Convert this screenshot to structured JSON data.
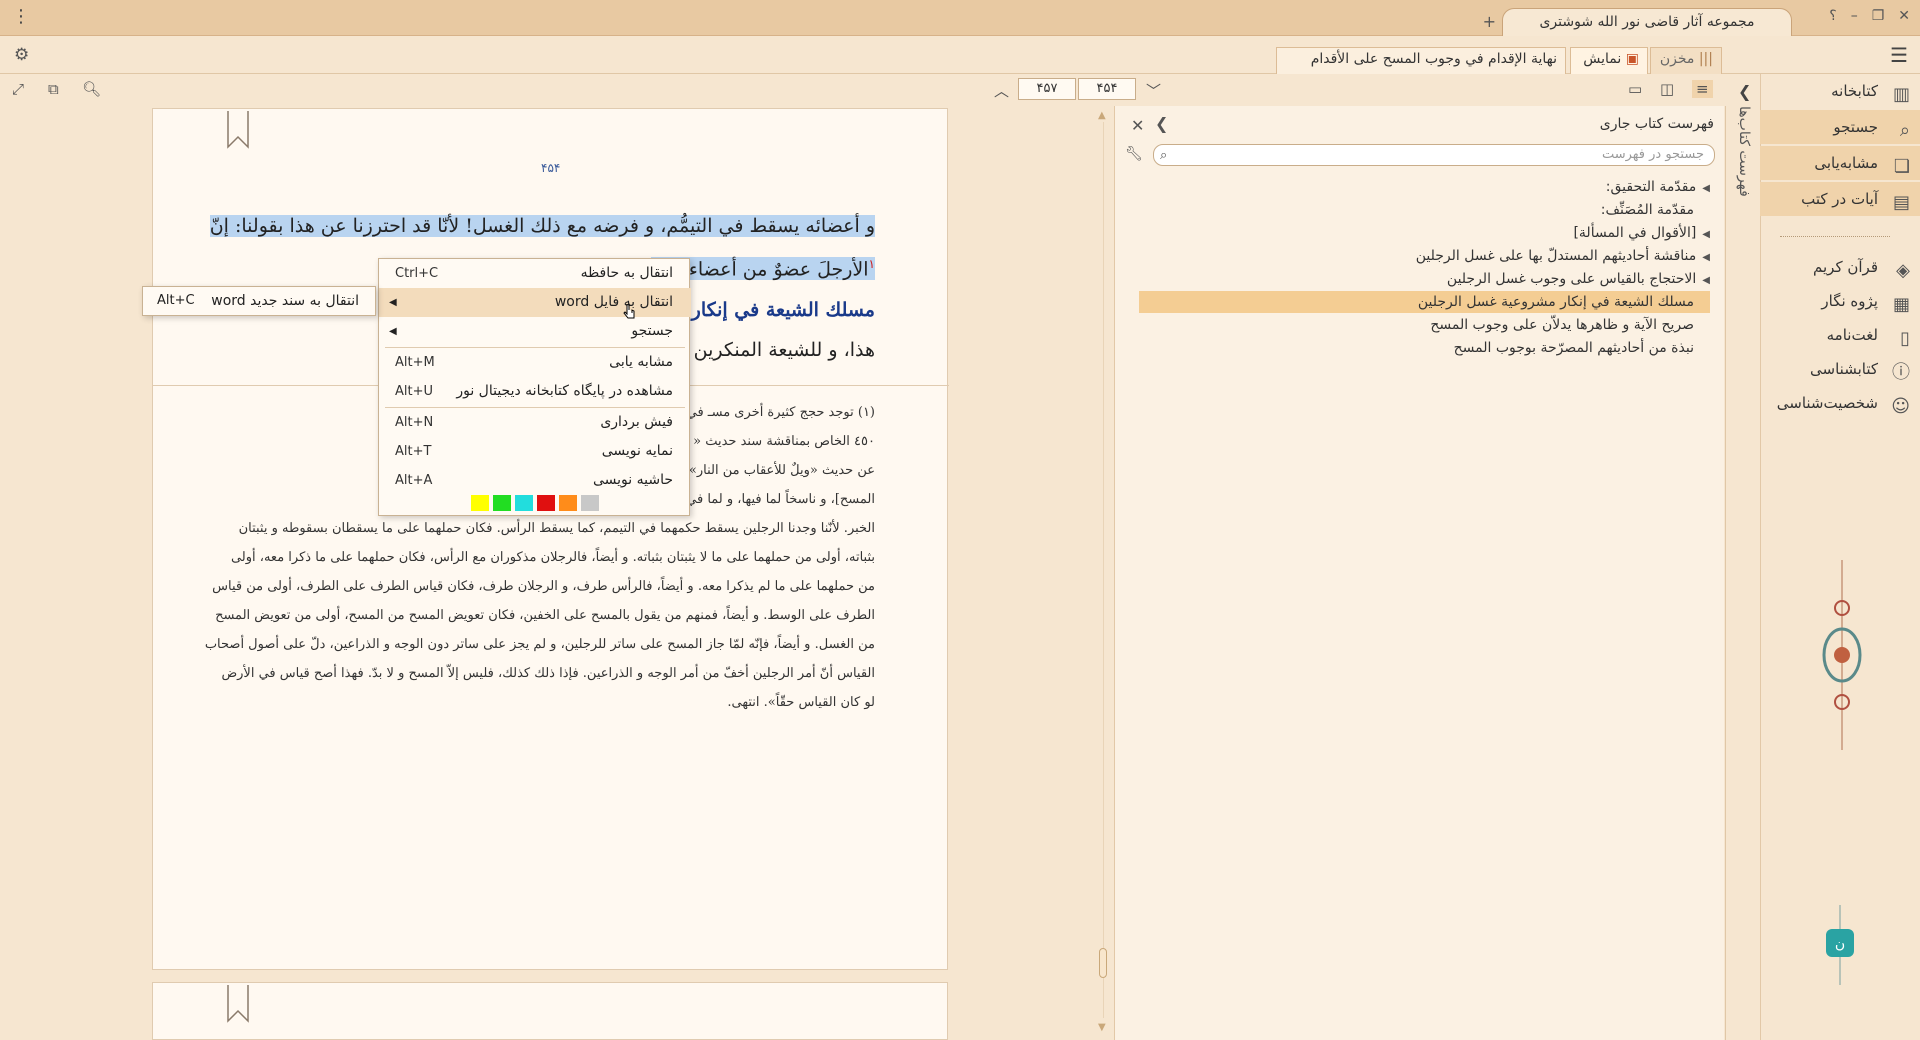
{
  "app": {
    "title": "مجموعه آثار قاضی نور الله شوشتری",
    "add_tab": "+",
    "help": "؟",
    "minimize": "–",
    "restore": "❐",
    "close": "✕"
  },
  "tabs": {
    "store": "مخزن",
    "view": "نمایش",
    "book": "نهاية الإقدام في وجوب المسح على الأقدام"
  },
  "toolbar": {
    "page_current": "۴۵۴",
    "page_total": "۴۵۷"
  },
  "nav": {
    "items": [
      {
        "label": "کتابخانه",
        "icon": "library-icon"
      },
      {
        "label": "جستجو",
        "icon": "search-icon"
      },
      {
        "label": "مشابه‌یابی",
        "icon": "similar-icon"
      },
      {
        "label": "آیات در کتب",
        "icon": "verses-icon"
      },
      {
        "label": "قرآن کریم",
        "icon": "quran-icon"
      },
      {
        "label": "پژوه نگار",
        "icon": "notes-icon"
      },
      {
        "label": "لغت‌نامه",
        "icon": "dictionary-icon"
      },
      {
        "label": "کتابشناسی",
        "icon": "bibliography-icon"
      },
      {
        "label": "شخصیت‌شناسی",
        "icon": "person-icon"
      }
    ],
    "vertical_tab": "فهرست کتاب‌ها"
  },
  "toc": {
    "title": "فهرست کتاب جاری",
    "search_placeholder": "جستجو در فهرست",
    "rows": [
      {
        "label": "مقدّمة التحقيق:",
        "expandable": true
      },
      {
        "label": "مقدّمة المُصَنِّف:",
        "expandable": false
      },
      {
        "label": "[الأقوال في المسألة]",
        "expandable": true
      },
      {
        "label": "مناقشة أحاديثهم المستدلّ بها على غسل الرجلين",
        "expandable": true
      },
      {
        "label": "الاحتجاج بالقياس على وجوب غسل الرجلين",
        "expandable": true
      },
      {
        "label": "مسلك الشيعة في إنكار مشروعية غسل الرجلين",
        "expandable": false,
        "selected": true
      },
      {
        "label": "صريح الآية و ظاهرها يدلاّن على وجوب المسح",
        "expandable": false
      },
      {
        "label": "نبذة من أحاديثهم المصرّحة بوجوب المسح",
        "expandable": false
      }
    ]
  },
  "page": {
    "number": "۴۵۴",
    "lines": [
      "و أعضائه يسقط في التيمُّم، و فرضه مع ذلك الغسل! لأنّا قد احترزنا عن هذا بقولنا: إنّ",
      "الأرجلَ عضوٌ من أعضاء الطـ",
      "مسلك الشيعة في إنكار مشـ",
      "هذا، و للشيعة المنكرين لـ"
    ],
    "footnotes": [
      "(١) توجد حجج كثيرة أخرى مسـ                                         في آخر الهامش رقم ١ ص",
      "٤٥٠ الخاص بمناقشة سند حديث «                              المحلّى ٥٧/٢ مسألة ٢٠٠",
      "عن حديث «ويلٌ للأعقاب من النار»                              ر التي ذكرنا [يعني بها أخبار",
      "المسح]، و ناسخاً لما فيها، و لما في                              الصحاح للقياس أن يترك هذا",
      "الخبر. لأنّنا وجدنا الرجلين يسقط حكمهما في التيمم، كما يسقط الرأس. فكان حملهما على ما يسقطان بسقوطه و يثبتان",
      "بثباته، أولى من حملهما على ما لا يثبتان بثباته. و أيضاً، فالرجلان مذكوران مع الرأس، فكان حملهما على ما ذكرا معه، أولى",
      "من حملهما على ما لم يذكرا معه. و أيضاً، فالرأس طرف، و الرجلان طرف، فكان قياس الطرف على الطرف، أولى من قياس",
      "الطرف على الوسط. و أيضاً، فمنهم من يقول بالمسح على الخفين، فكان تعويض المسح من المسح، أولى من تعويض المسح",
      "من الغسل. و أيضاً، فإنّه لمّا جاز المسح على ساتر للرجلين، و لم يجز على ساتر دون الوجه و الذراعين، دلّ على أصول أصحاب",
      "القياس أنّ أمر الرجلين أخفّ من أمر الوجه و الذراعين. فإذا ذلك كذلك، فليس إلاّ المسح و لا بدّ. فهذا أصح قياس في الأرض",
      "لو كان القياس حقّاً». انتهى."
    ],
    "footnote_marker": "١"
  },
  "context_menu": {
    "items": [
      {
        "label": "انتقال به حافظه",
        "shortcut": "Ctrl+C"
      },
      {
        "label": "انتقال به فایل word",
        "submenu": true,
        "hover": true
      },
      {
        "label": "جستجو",
        "submenu": true
      },
      {
        "label": "مشابه یابی",
        "shortcut": "Alt+M"
      },
      {
        "label": "مشاهده در پایگاه کتابخانه دیجیتال نور",
        "shortcut": "Alt+U"
      },
      {
        "label": "فیش برداری",
        "shortcut": "Alt+N"
      },
      {
        "label": "نمایه نویسی",
        "shortcut": "Alt+T"
      },
      {
        "label": "حاشیه نویسی",
        "shortcut": "Alt+A"
      }
    ],
    "colors": [
      "#ffff00",
      "#22dd22",
      "#22dddd",
      "#e01010",
      "#ff8c1a",
      "#c8c8c8"
    ]
  },
  "submenu": {
    "label": "انتقال به سند جدید word",
    "shortcut": "Alt+C"
  }
}
